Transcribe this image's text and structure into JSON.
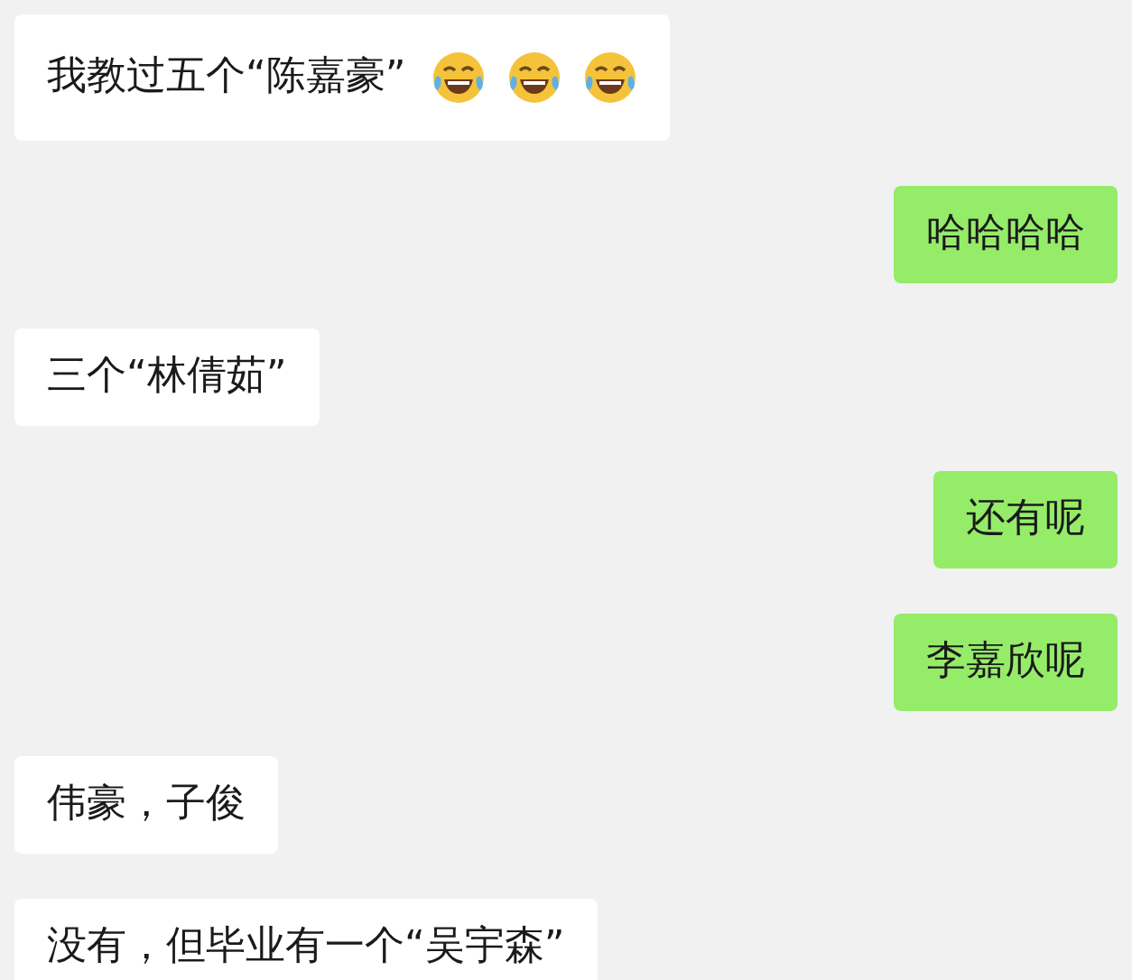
{
  "messages": [
    {
      "sent": false,
      "text": "我教过五个“陈嘉豪”",
      "emoji": [
        {
          "kind": "tears-of-joy"
        },
        {
          "kind": "tears-of-joy"
        },
        {
          "kind": "tears-of-joy"
        }
      ]
    },
    {
      "sent": true,
      "text": "哈哈哈哈"
    },
    {
      "sent": false,
      "text": "三个“林倩茹”"
    },
    {
      "sent": true,
      "text": "还有呢"
    },
    {
      "sent": true,
      "text": "李嘉欣呢"
    },
    {
      "sent": false,
      "text": "伟豪，子俊"
    },
    {
      "sent": false,
      "text": "没有，但毕业有一个“吴宇森”"
    }
  ]
}
